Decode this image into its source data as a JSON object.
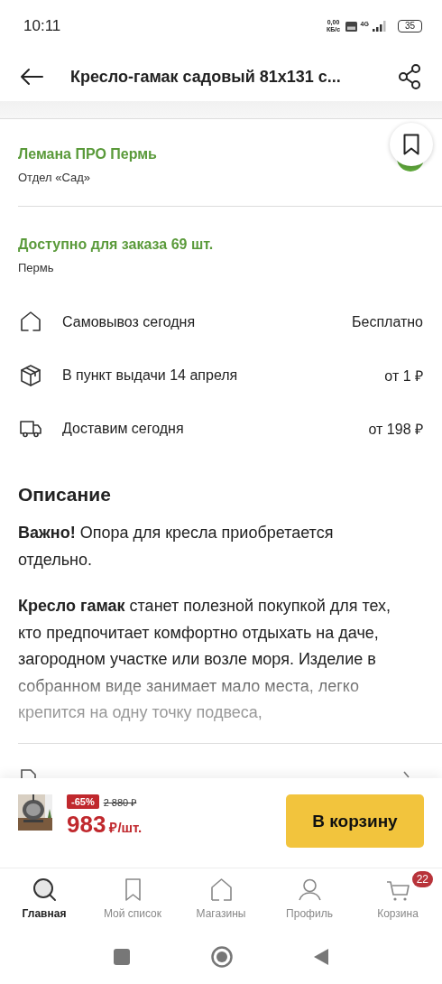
{
  "status_bar": {
    "time": "10:11",
    "net_speed": "0,00 КБ/с",
    "network": "4G",
    "battery": "35"
  },
  "header": {
    "title": "Кресло-гамак садовый 81х131 с..."
  },
  "store": {
    "name": "Лемана ПРО Пермь",
    "department": "Отдел «Сад»"
  },
  "availability": {
    "title": "Доступно для заказа 69 шт.",
    "city": "Пермь"
  },
  "delivery_options": [
    {
      "kind": "pickup",
      "label": "Самовывоз сегодня",
      "price": "Бесплатно"
    },
    {
      "kind": "pickup_point",
      "label": "В пункт выдачи 14 апреля",
      "price": "от 1 ₽"
    },
    {
      "kind": "courier",
      "label": "Доставим сегодня",
      "price": "от 198 ₽"
    }
  ],
  "description": {
    "heading": "Описание",
    "paragraphs": [
      "**Важно!** Опора для кресла приобретается отдельно.",
      "**Кресло гамак** станет полезной покупкой для тех, кто предпочитает комфортно отдыхать на даче, загородном участке или возле моря. Изделие в собранном виде занимает мало места, легко крепится на одну точку подвеса,"
    ]
  },
  "buy_bar": {
    "discount": "-65%",
    "old_price": "2 880 ₽",
    "price": "983",
    "unit": "₽/шт.",
    "button": "В корзину"
  },
  "bottom_nav": [
    {
      "kind": "search",
      "label": "Главная",
      "selected": true
    },
    {
      "kind": "bookmark",
      "label": "Мой список",
      "selected": false
    },
    {
      "kind": "home",
      "label": "Магазины",
      "selected": false
    },
    {
      "kind": "person",
      "label": "Профиль",
      "selected": false
    },
    {
      "kind": "cart",
      "label": "Корзина",
      "selected": false,
      "badge": "22"
    }
  ]
}
